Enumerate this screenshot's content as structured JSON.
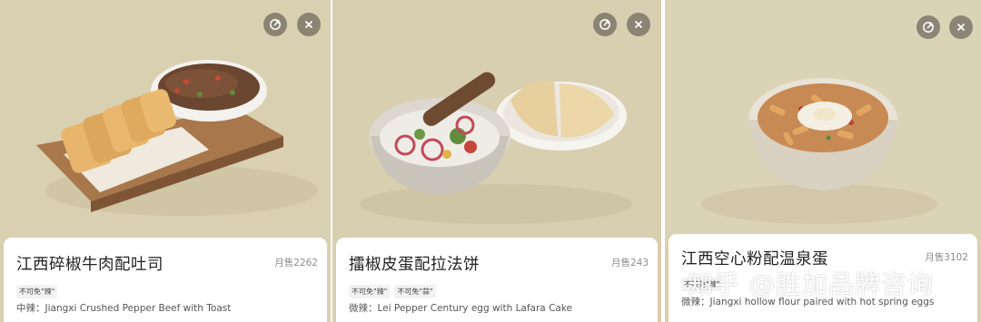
{
  "cards": [
    {
      "title": "江西碎椒牛肉配吐司",
      "sales": "月售2262",
      "tags": [
        "不可免\"辣\""
      ],
      "desc": "中辣：Jiangxi Crushed Pepper Beef with Toast"
    },
    {
      "title": "擂椒皮蛋配拉法饼",
      "sales": "月售243",
      "tags": [
        "不可免\"辣\"",
        "不可免\"蒜\""
      ],
      "desc": "微辣：Lei Pepper Century egg with Lafara Cake"
    },
    {
      "title": "江西空心粉配温泉蛋",
      "sales": "月售3102",
      "tags": [
        "不可免\"辣\""
      ],
      "desc": "微辣：Jiangxi hollow flour paired with hot spring eggs"
    }
  ],
  "watermark": "知乎 @胜加品牌咨询",
  "icons": {
    "share": "share-icon",
    "close": "close-icon"
  },
  "colors": {
    "background": "#d8cfb0",
    "card": "#ffffff",
    "title": "#222222",
    "sales": "#8c8c8c"
  }
}
